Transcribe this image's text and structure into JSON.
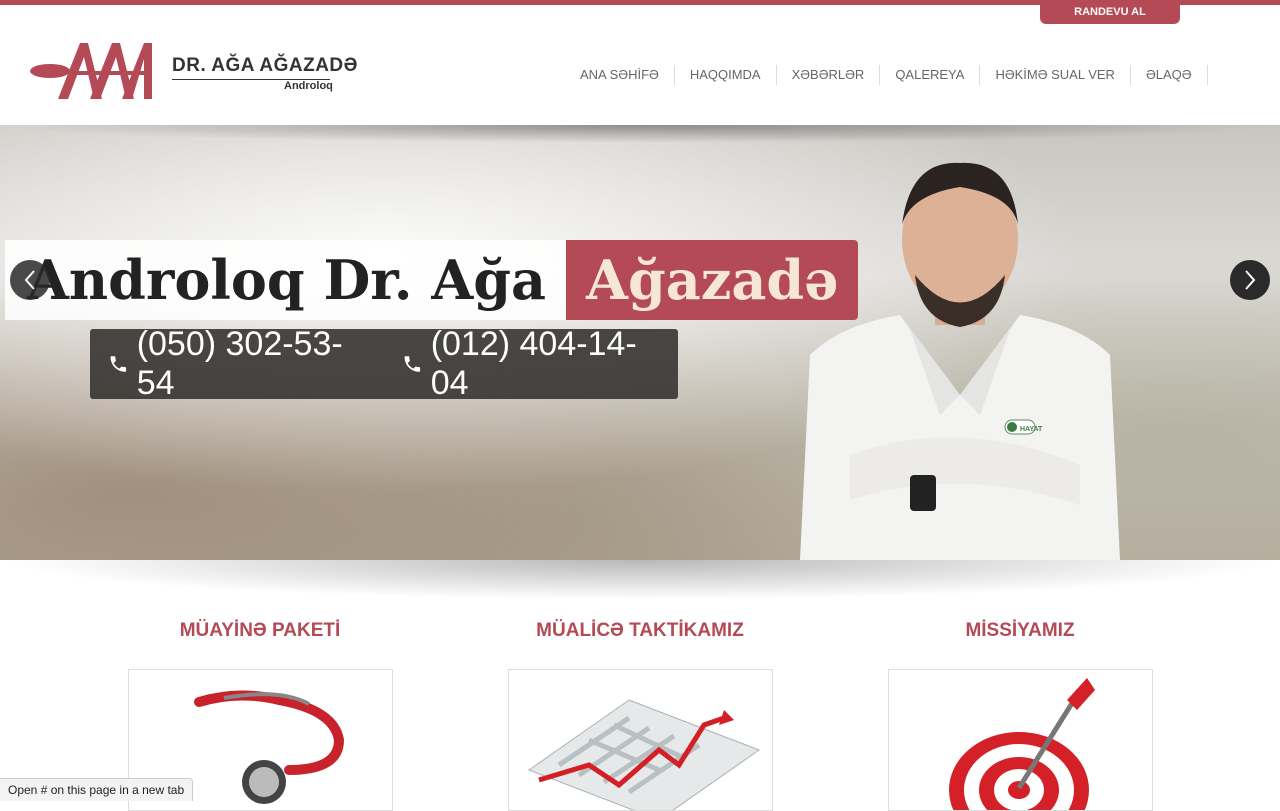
{
  "colors": {
    "brand": "#b54a57",
    "nav_text": "#666666",
    "dark_box": "#32302e"
  },
  "header": {
    "appointment_label": "RANDEVU AL",
    "logo": {
      "mark": "AAA",
      "name": "DR. AĞA AĞAZADƏ",
      "subtitle": "Androloq"
    },
    "nav": [
      {
        "label": "ANA SƏHİFƏ"
      },
      {
        "label": "HAQQIMDA"
      },
      {
        "label": "XƏBƏRLƏR"
      },
      {
        "label": "QALEREYA"
      },
      {
        "label": "HƏKİMƏ SUAL VER"
      },
      {
        "label": "ƏLAQƏ"
      }
    ]
  },
  "hero": {
    "title_part1": "Androloq Dr. Ağa",
    "title_part2": "Ağazadə",
    "phones": [
      "(050) 302-53-54",
      "(012) 404-14-04"
    ],
    "icons": {
      "prev": "chevron-left-icon",
      "next": "chevron-right-icon",
      "phone": "phone-icon"
    },
    "badge_text": "HAYAT"
  },
  "sections": [
    {
      "title": "MÜAYİNƏ PAKETİ",
      "image": "stethoscope"
    },
    {
      "title": "MÜALİCƏ TAKTİKAMIZ",
      "image": "maze"
    },
    {
      "title": "MİSSİYAMIZ",
      "image": "dart-target"
    }
  ],
  "status_bar": {
    "text": "Open # on this page in a new tab"
  }
}
